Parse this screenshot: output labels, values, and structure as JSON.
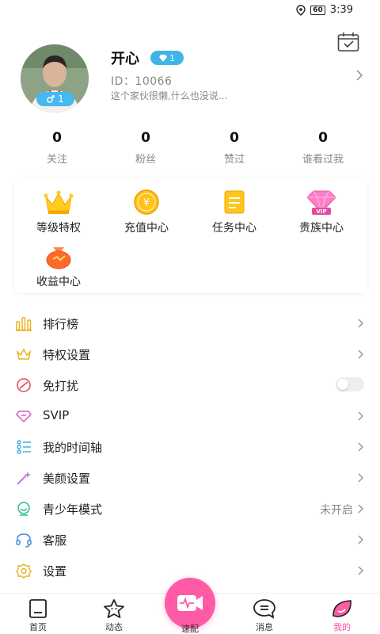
{
  "status_bar": {
    "battery": "60",
    "time": "3:39"
  },
  "profile": {
    "nickname": "开心",
    "level": "1",
    "gender_level": "1",
    "user_id": "ID：10066",
    "bio": "这个家伙很懒,什么也没说..."
  },
  "stats": [
    {
      "value": "0",
      "label": "关注"
    },
    {
      "value": "0",
      "label": "粉丝"
    },
    {
      "value": "0",
      "label": "赞过"
    },
    {
      "value": "0",
      "label": "谁看过我"
    }
  ],
  "features": [
    {
      "label": "等级特权",
      "icon": "crown-icon"
    },
    {
      "label": "充值中心",
      "icon": "coin-icon"
    },
    {
      "label": "任务中心",
      "icon": "task-icon"
    },
    {
      "label": "贵族中心",
      "icon": "vip-diamond-icon"
    },
    {
      "label": "收益中心",
      "icon": "money-bag-icon"
    }
  ],
  "vip_badge_text": "VIP",
  "menu": [
    {
      "label": "排行榜",
      "icon": "ranking-icon"
    },
    {
      "label": "特权设置",
      "icon": "privilege-icon"
    },
    {
      "label": "免打扰",
      "icon": "do-not-disturb-icon"
    },
    {
      "label": "SVIP",
      "icon": "svip-icon"
    },
    {
      "label": "我的时间轴",
      "icon": "timeline-icon"
    },
    {
      "label": "美颜设置",
      "icon": "beauty-wand-icon"
    },
    {
      "label": "青少年模式",
      "icon": "teen-mode-icon",
      "value": "未开启"
    },
    {
      "label": "客服",
      "icon": "headset-icon"
    },
    {
      "label": "设置",
      "icon": "settings-icon"
    }
  ],
  "tabs": [
    {
      "label": "首页",
      "icon": "home-icon"
    },
    {
      "label": "动态",
      "icon": "star-icon"
    },
    {
      "label": "速配",
      "icon": "video-match-icon"
    },
    {
      "label": "消息",
      "icon": "message-icon"
    },
    {
      "label": "我的",
      "icon": "profile-leaf-icon",
      "active": true
    }
  ],
  "colors": {
    "accent": "#ff5aa5",
    "badge_blue": "#40b4e8",
    "text_gray": "#888888"
  }
}
